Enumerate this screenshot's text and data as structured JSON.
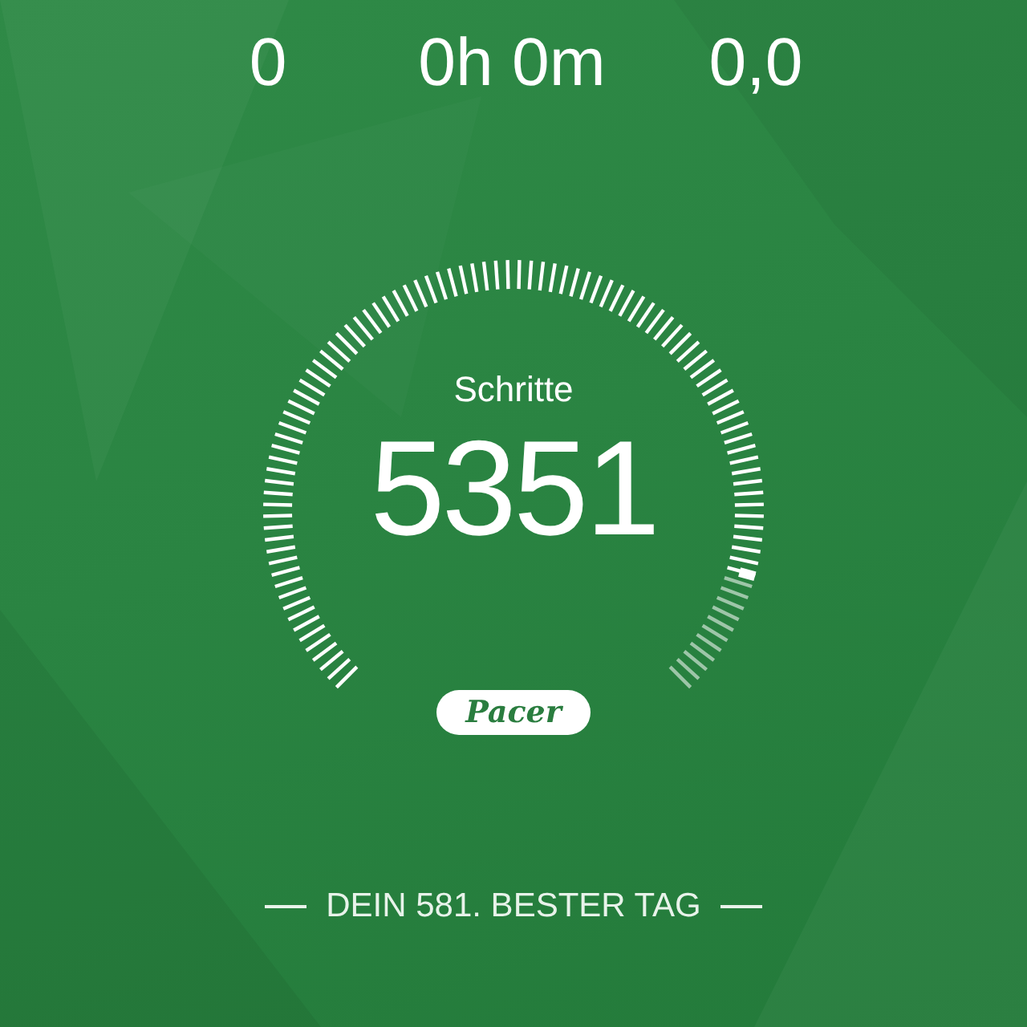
{
  "stats": [
    {
      "value": "0"
    },
    {
      "value": "0h 0m"
    },
    {
      "value": "0,0"
    }
  ],
  "gauge": {
    "label": "Schritte",
    "value": "5351"
  },
  "logo": {
    "text": "Pacer"
  },
  "footer": {
    "text": "DEIN 581. BESTER TAG"
  }
}
